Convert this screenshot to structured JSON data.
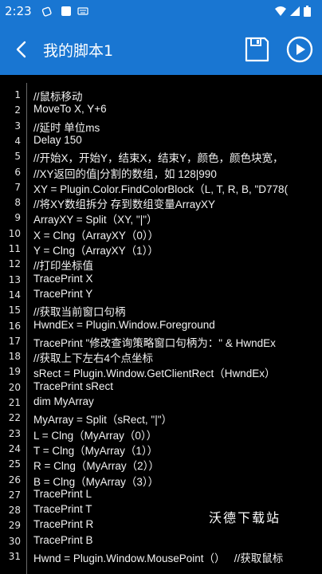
{
  "status_bar": {
    "time": "2:23"
  },
  "app_bar": {
    "title": "我的脚本1"
  },
  "editor": {
    "lines": [
      {
        "n": "1",
        "t": "//鼠标移动"
      },
      {
        "n": "2",
        "t": "MoveTo X, Y+6"
      },
      {
        "n": "3",
        "t": "//延时 单位ms"
      },
      {
        "n": "4",
        "t": "Delay 150"
      },
      {
        "n": "5",
        "t": "//开始X，开始Y，结束X，结束Y，颜色，颜色块宽，"
      },
      {
        "n": "6",
        "t": "//XY返回的值|分割的数组，如 128|990"
      },
      {
        "n": "7",
        "t": "XY = Plugin.Color.FindColorBlock（L, T, R, B, \"D778("
      },
      {
        "n": "8",
        "t": "//将XY数组拆分 存到数组变量ArrayXY"
      },
      {
        "n": "9",
        "t": "ArrayXY = Split（XY, \"|\"）"
      },
      {
        "n": "10",
        "t": "X = Clng（ArrayXY（0））"
      },
      {
        "n": "11",
        "t": "Y = Clng（ArrayXY（1））"
      },
      {
        "n": "12",
        "t": "//打印坐标值"
      },
      {
        "n": "13",
        "t": "TracePrint X"
      },
      {
        "n": "14",
        "t": "TracePrint Y"
      },
      {
        "n": "15",
        "t": "//获取当前窗口句柄"
      },
      {
        "n": "16",
        "t": "HwndEx = Plugin.Window.Foreground"
      },
      {
        "n": "17",
        "t": "TracePrint \"修改查询策略窗口句柄为：\" & HwndEx"
      },
      {
        "n": "18",
        "t": "//获取上下左右4个点坐标"
      },
      {
        "n": "19",
        "t": "sRect = Plugin.Window.GetClientRect（HwndEx）"
      },
      {
        "n": "20",
        "t": "TracePrint sRect"
      },
      {
        "n": "21",
        "t": "dim MyArray"
      },
      {
        "n": "22",
        "t": "MyArray = Split（sRect, \"|\"）"
      },
      {
        "n": "23",
        "t": "L = Clng（MyArray（0））"
      },
      {
        "n": "24",
        "t": "T = Clng（MyArray（1））"
      },
      {
        "n": "25",
        "t": "R = Clng（MyArray（2））"
      },
      {
        "n": "26",
        "t": "B = Clng（MyArray（3））"
      },
      {
        "n": "27",
        "t": "TracePrint L"
      },
      {
        "n": "28",
        "t": "TracePrint T"
      },
      {
        "n": "29",
        "t": "TracePrint R"
      },
      {
        "n": "30",
        "t": "TracePrint B"
      },
      {
        "n": "31",
        "t": "Hwnd = Plugin.Window.MousePoint（）   //获取鼠标"
      }
    ]
  },
  "watermark": "沃德下载站",
  "colors": {
    "accent": "#1976d2",
    "editor_bg": "#000000",
    "text": "#f2f2f2"
  }
}
